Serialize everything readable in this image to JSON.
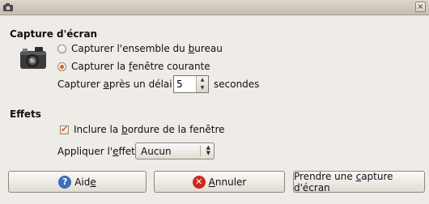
{
  "window": {
    "close_glyph": "×"
  },
  "capture": {
    "title": "Capture d'écran",
    "radio_desktop": {
      "pre": "Capturer l'ensemble du ",
      "mn": "b",
      "post": "ureau",
      "checked": false
    },
    "radio_window": {
      "pre": "Capturer la ",
      "mn": "f",
      "post": "enêtre courante",
      "checked": true
    },
    "delay": {
      "pre": "Capturer ",
      "mn": "a",
      "post": "près un délai de",
      "value": "5",
      "suffix": "secondes"
    }
  },
  "effects": {
    "title": "Effets",
    "border": {
      "pre": "Inclure la ",
      "mn": "b",
      "post": "ordure de la fenêtre",
      "checked": true
    },
    "effect": {
      "pre": "Appliquer l'",
      "mn": "e",
      "post": "ffet :",
      "selected": "Aucun"
    }
  },
  "buttons": {
    "help": {
      "pre": "Aid",
      "mn": "e",
      "post": "",
      "icon": "?"
    },
    "cancel": {
      "pre": "",
      "mn": "A",
      "post": "nnuler",
      "icon": "✕"
    },
    "capture": {
      "pre": "Prendre une ",
      "mn": "c",
      "post": "apture d'écran"
    }
  },
  "colors": {
    "accent": "#e2620f",
    "help_icon": "#3b6fb6",
    "cancel_icon": "#cc2a1c"
  },
  "icons": {
    "window": "camera-icon",
    "help": "help-icon",
    "cancel": "cancel-icon",
    "close": "close-icon"
  }
}
